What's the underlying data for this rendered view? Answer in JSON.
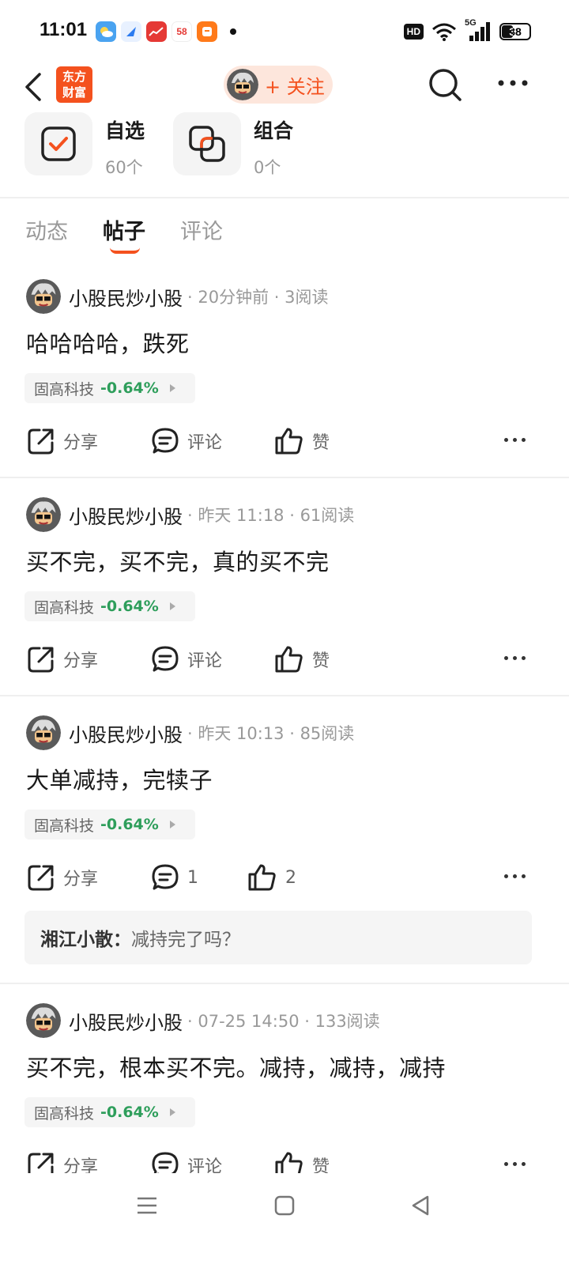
{
  "status_bar": {
    "time": "11:01",
    "battery": "38",
    "battery_level": 0.38,
    "hd_badge": "HD",
    "network": "5G",
    "app_icons": [
      "weather-app-icon",
      "browser-app-icon",
      "stock-app-icon",
      "58-app-icon",
      "taobao-app-icon"
    ]
  },
  "nav": {
    "logo_line1": "东方",
    "logo_line2": "财富",
    "follow_label": "+ 关注"
  },
  "collections": [
    {
      "title": "自选",
      "count": "60个"
    },
    {
      "title": "组合",
      "count": "0个"
    }
  ],
  "tabs": [
    {
      "label": "动态",
      "active": false
    },
    {
      "label": "帖子",
      "active": true
    },
    {
      "label": "评论",
      "active": false
    }
  ],
  "posts": [
    {
      "author": "小股民炒小股",
      "meta": "· 20分钟前 · 3阅读",
      "body": "哈哈哈哈，跌死",
      "stock_name": "固高科技",
      "stock_change": "-0.64%",
      "share": "分享",
      "comment": "评论",
      "like": "赞"
    },
    {
      "author": "小股民炒小股",
      "meta": "· 昨天 11:18 · 61阅读",
      "body": "买不完，买不完，真的买不完",
      "stock_name": "固高科技",
      "stock_change": "-0.64%",
      "share": "分享",
      "comment": "评论",
      "like": "赞"
    },
    {
      "author": "小股民炒小股",
      "meta": "· 昨天 10:13 · 85阅读",
      "body": "大单减持，完犊子",
      "stock_name": "固高科技",
      "stock_change": "-0.64%",
      "share": "分享",
      "comment": "1",
      "like": "2",
      "reply_user": "湘江小散：",
      "reply_text": "减持完了吗？"
    },
    {
      "author": "小股民炒小股",
      "meta": "· 07-25 14:50 · 133阅读",
      "body": "买不完，根本买不完。减持，减持，减持",
      "stock_name": "固高科技",
      "stock_change": "-0.64%",
      "share": "分享",
      "comment": "评论",
      "like": "赞"
    }
  ],
  "colors": {
    "accent": "#f4511e",
    "stock_down": "#2e9e5b",
    "follow_bg": "#fde6dc"
  }
}
